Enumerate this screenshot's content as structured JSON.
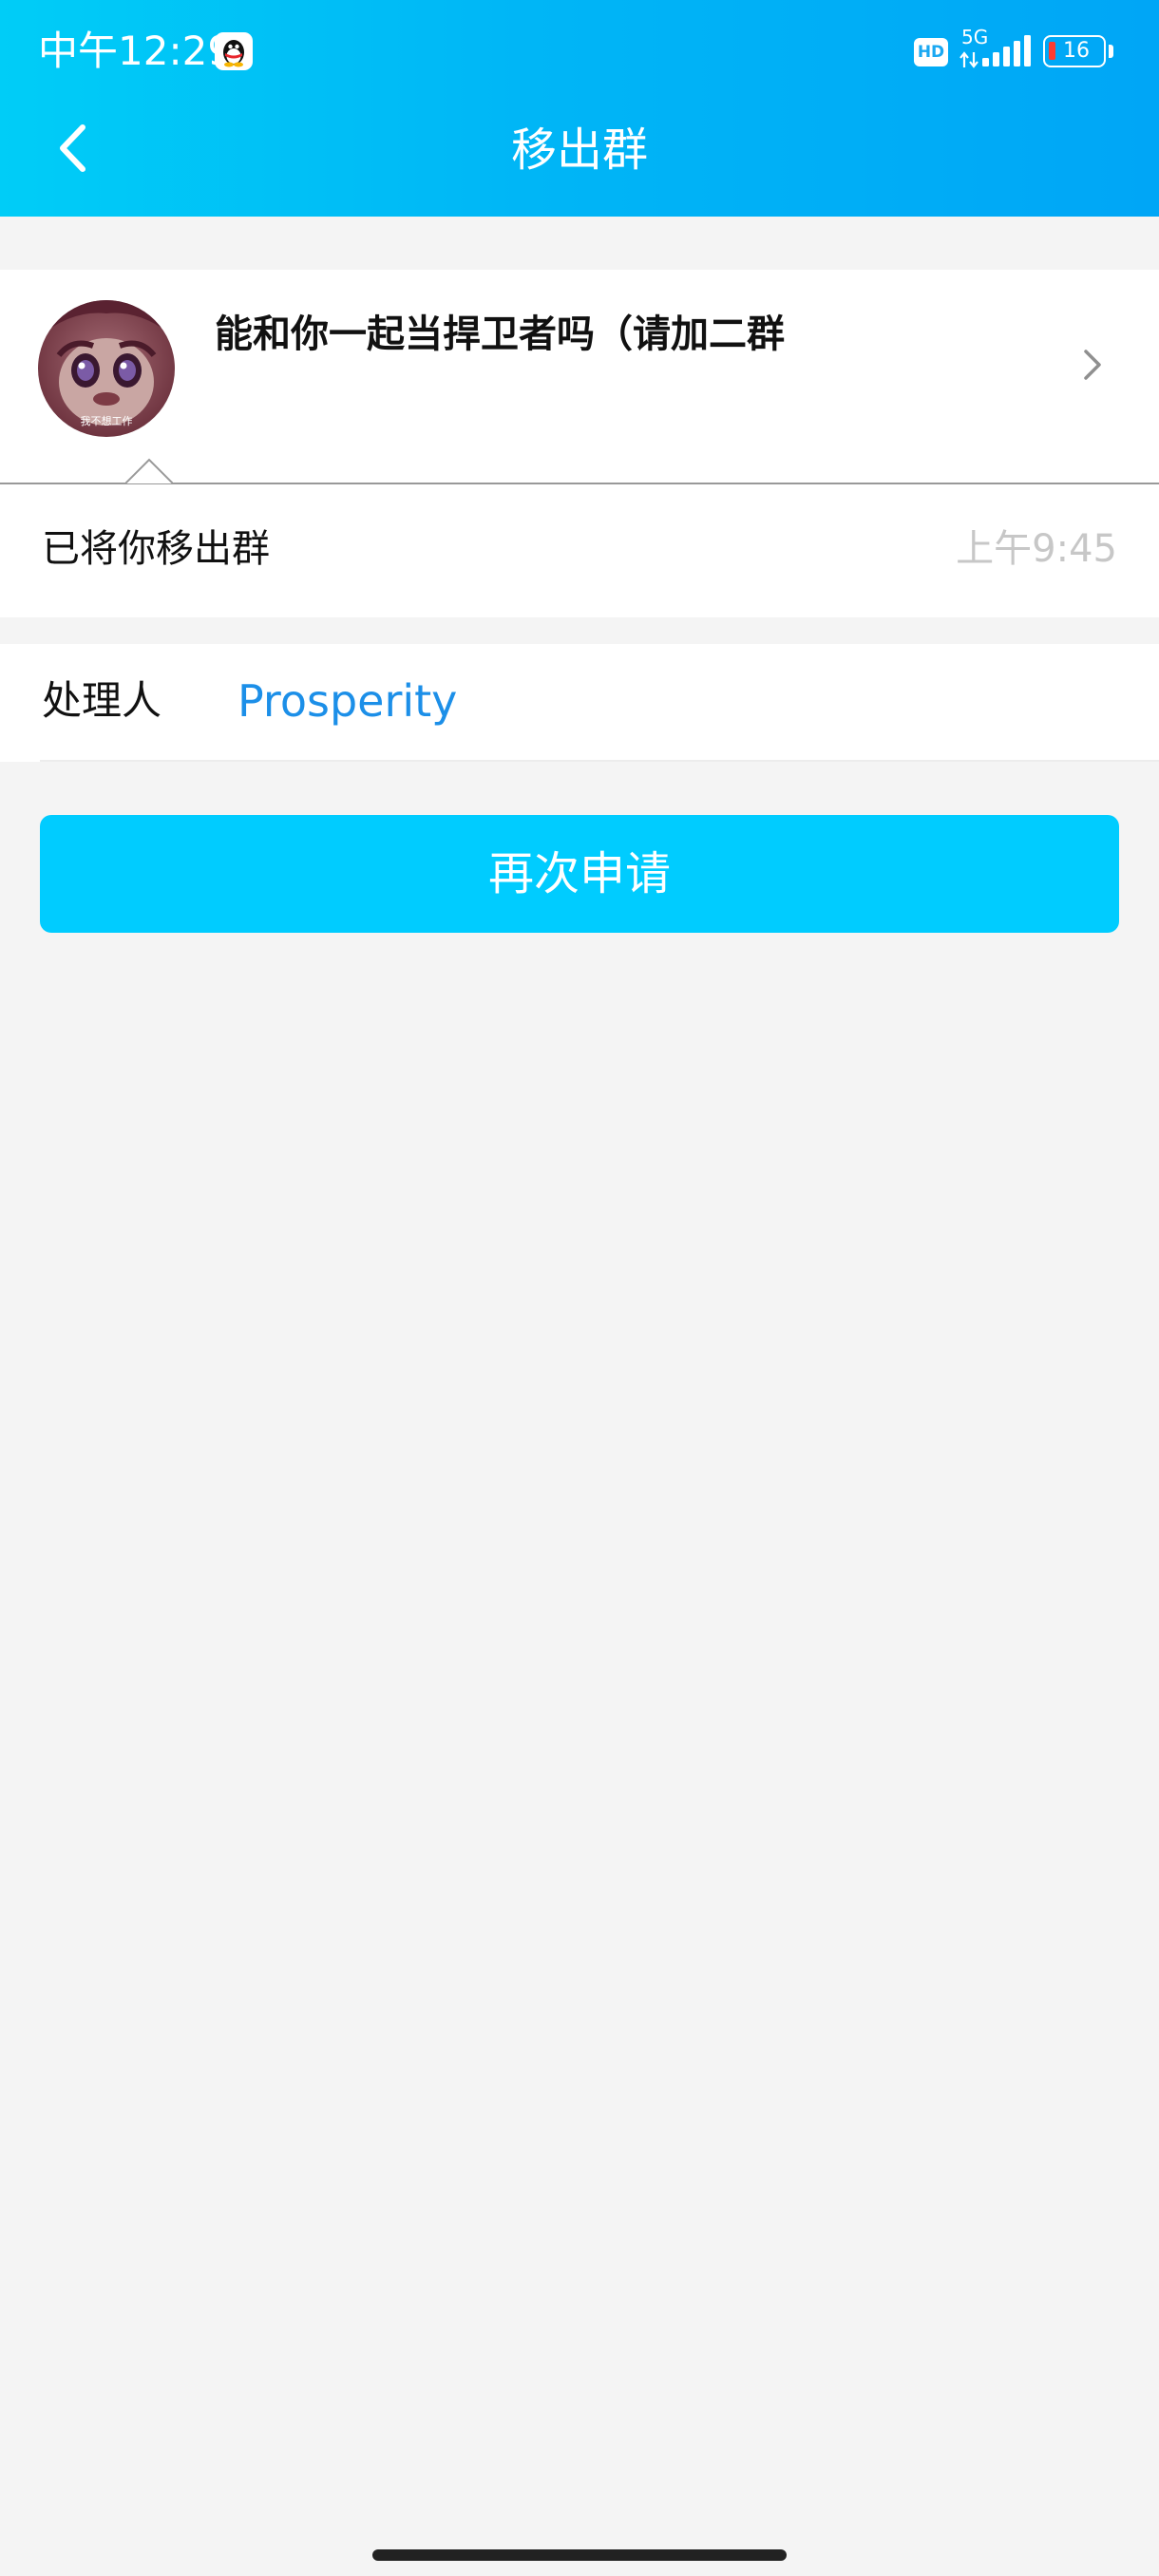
{
  "status_bar": {
    "time": "中午12:29",
    "hd_label": "HD",
    "network_label": "5G",
    "battery_level": "16"
  },
  "header": {
    "title": "移出群",
    "back_icon": "chevron-left-icon"
  },
  "group": {
    "name": "能和你一起当捍卫者吗（请加二群",
    "avatar_caption": "我不想工作"
  },
  "message": {
    "text": "已将你移出群",
    "time": "上午9:45"
  },
  "handler": {
    "label": "处理人",
    "name": "Prosperity"
  },
  "actions": {
    "reapply_label": "再次申请"
  },
  "colors": {
    "header_start": "#00cdf7",
    "header_end": "#00a6f6",
    "button": "#00ccff",
    "link": "#1c8fe8",
    "background": "#f4f4f4"
  }
}
